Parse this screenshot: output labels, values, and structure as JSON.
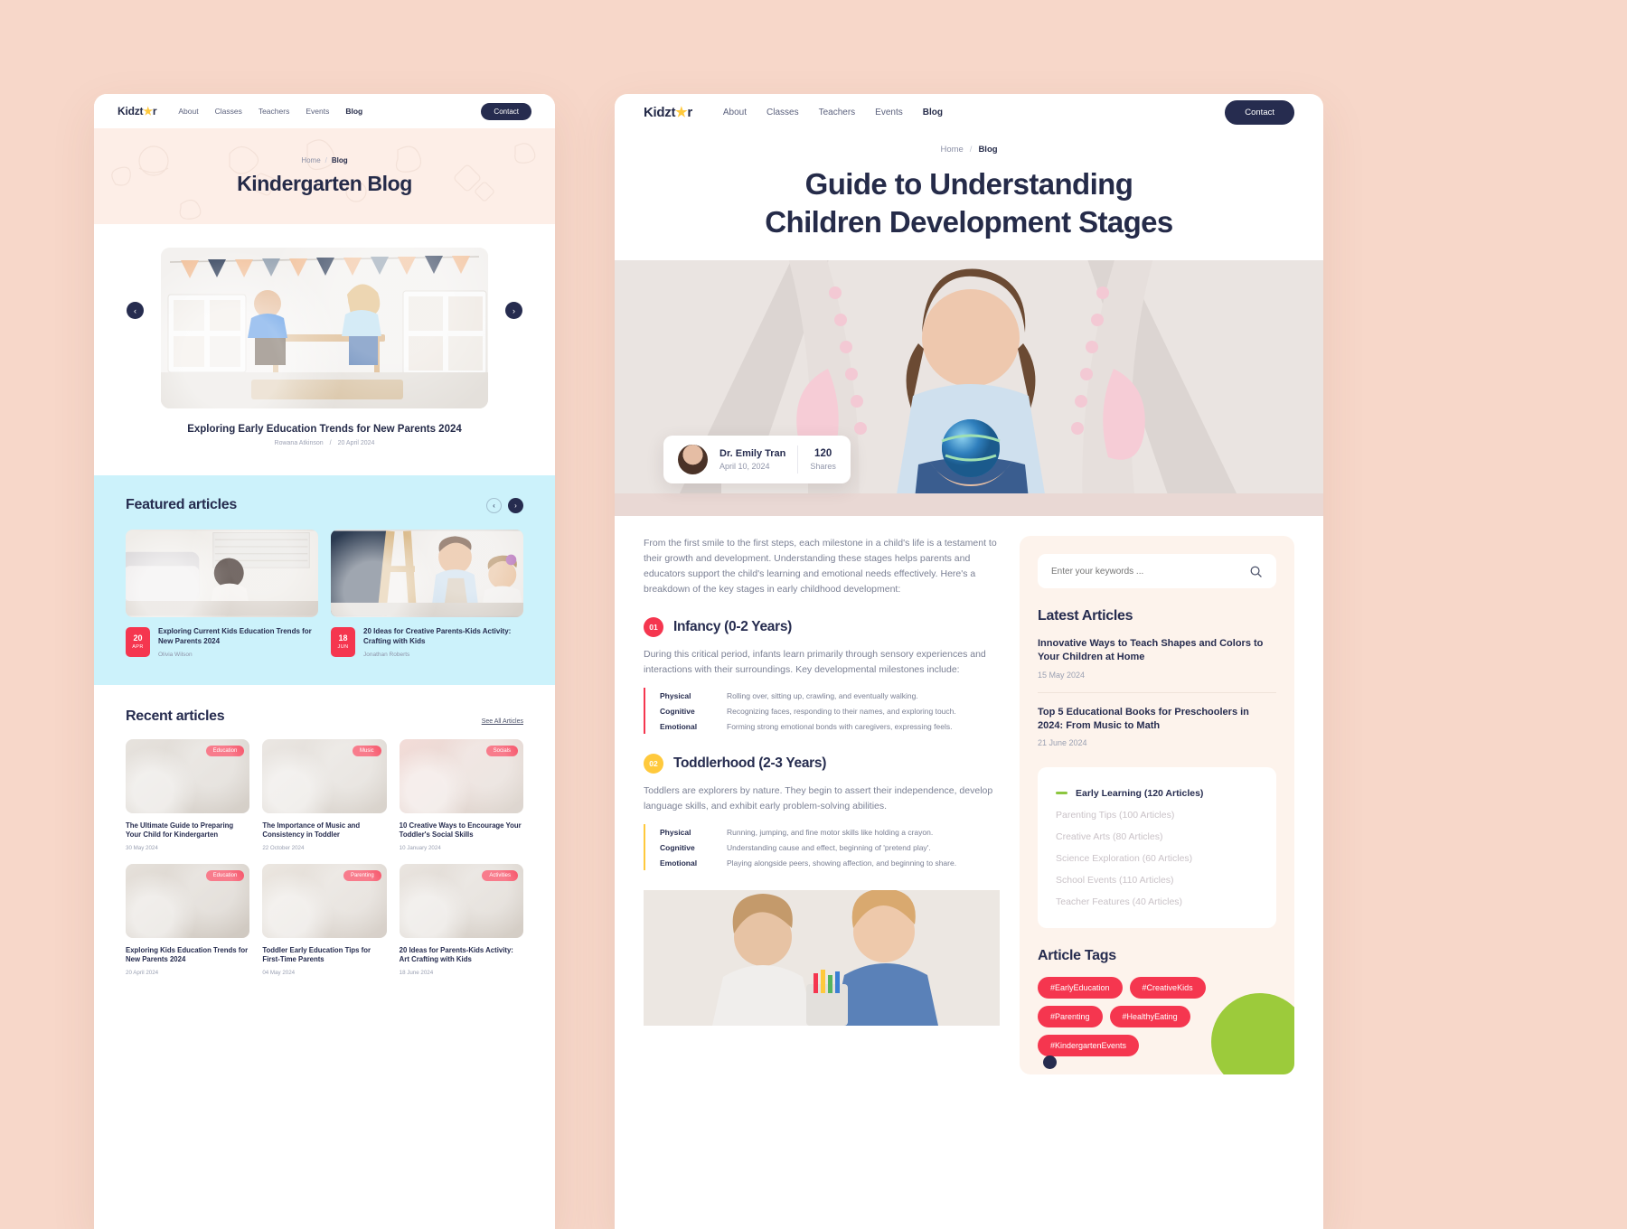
{
  "brand": {
    "name_pre": "Kidzt",
    "star": "★",
    "name_post": "r"
  },
  "nav": {
    "links": [
      "About",
      "Classes",
      "Teachers",
      "Events",
      "Blog"
    ],
    "active": "Blog",
    "contact_label": "Contact"
  },
  "left": {
    "breadcrumb": {
      "home": "Home",
      "sep": "/",
      "current": "Blog"
    },
    "page_title": "Kindergarten Blog",
    "slider": {
      "prev_icon": "‹",
      "next_icon": "›",
      "slide_title": "Exploring Early Education Trends for New Parents 2024",
      "author": "Rowana Atkinson",
      "sep": "/",
      "date": "20 April 2024"
    },
    "featured": {
      "heading": "Featured articles",
      "prev_icon": "‹",
      "next_icon": "›",
      "cards": [
        {
          "day": "20",
          "month": "APR",
          "title": "Exploring Current Kids Education Trends for New Parents 2024",
          "author": "Olivia Wilson"
        },
        {
          "day": "18",
          "month": "JUN",
          "title": "20 Ideas for Creative Parents-Kids Activity: Crafting with Kids",
          "author": "Jonathan Roberts"
        }
      ]
    },
    "recent": {
      "heading": "Recent articles",
      "see_all": "See All Articles",
      "cards": [
        {
          "badge": "Education",
          "title": "The Ultimate Guide to Preparing Your Child for Kindergarten",
          "date": "30 May 2024"
        },
        {
          "badge": "Music",
          "title": "The Importance of Music and Consistency in Toddler",
          "date": "22 October 2024"
        },
        {
          "badge": "Socials",
          "title": "10 Creative Ways to Encourage Your Toddler's Social Skills",
          "date": "10 January 2024"
        },
        {
          "badge": "Education",
          "title": "Exploring Kids Education Trends for New Parents 2024",
          "date": "20 April 2024"
        },
        {
          "badge": "Parenting",
          "title": "Toddler Early Education Tips for First-Time Parents",
          "date": "04 May 2024"
        },
        {
          "badge": "Activities",
          "title": "20 Ideas for Parents-Kids Activity: Art Crafting with Kids",
          "date": "18 June 2024"
        }
      ]
    }
  },
  "right": {
    "breadcrumb": {
      "home": "Home",
      "sep": "/",
      "current": "Blog"
    },
    "title_line1": "Guide to Understanding",
    "title_line2": "Children Development Stages",
    "author_card": {
      "name": "Dr. Emily Tran",
      "date": "April 10, 2024",
      "shares_count": "120",
      "shares_label": "Shares"
    },
    "intro": "From the first smile to the first steps, each milestone in a child's life is a testament to their growth and development. Understanding these stages helps parents and educators support the child's learning and emotional needs effectively. Here's a breakdown of the key stages in early childhood development:",
    "stages": [
      {
        "num": "01",
        "num_color": "#f5364f",
        "title": "Infancy (0-2 Years)",
        "desc": "During this critical period, infants learn primarily through sensory experiences and interactions with their surroundings. Key developmental milestones include:",
        "milestones": [
          {
            "key": "Physical",
            "value": "Rolling over, sitting up, crawling, and eventually walking."
          },
          {
            "key": "Cognitive",
            "value": "Recognizing faces, responding to their names, and exploring touch."
          },
          {
            "key": "Emotional",
            "value": "Forming strong emotional bonds with caregivers, expressing feels."
          }
        ]
      },
      {
        "num": "02",
        "num_color": "#ffc93c",
        "title": "Toddlerhood (2-3 Years)",
        "desc": "Toddlers are explorers by nature. They begin to assert their independence, develop language skills, and exhibit early problem-solving abilities.",
        "milestones": [
          {
            "key": "Physical",
            "value": "Running, jumping, and fine motor skills like holding a crayon."
          },
          {
            "key": "Cognitive",
            "value": "Understanding cause and effect, beginning of 'pretend play'."
          },
          {
            "key": "Emotional",
            "value": "Playing alongside peers, showing affection, and beginning to share."
          }
        ]
      }
    ],
    "sidebar": {
      "search_placeholder": "Enter your keywords ...",
      "search_icon": "search-icon",
      "latest_heading": "Latest Articles",
      "latest": [
        {
          "title": "Innovative Ways to Teach Shapes and Colors to Your Children at Home",
          "date": "15 May 2024"
        },
        {
          "title": "Top 5 Educational Books for Preschoolers in 2024: From Music to Math",
          "date": "21 June 2024"
        }
      ],
      "categories": [
        {
          "label": "Early Learning (120 Articles)",
          "active": true
        },
        {
          "label": "Parenting Tips (100 Articles)",
          "active": false
        },
        {
          "label": "Creative Arts (80 Articles)",
          "active": false
        },
        {
          "label": "Science Exploration (60 Articles)",
          "active": false
        },
        {
          "label": "School Events (110 Articles)",
          "active": false
        },
        {
          "label": "Teacher Features (40 Articles)",
          "active": false
        }
      ],
      "tags_heading": "Article Tags",
      "tags": [
        "#EarlyEducation",
        "#CreativeKids",
        "#Parenting",
        "#HealthyEating",
        "#KindergartenEvents"
      ]
    }
  },
  "colors": {
    "accent_red": "#f5364f",
    "navy": "#262c4f",
    "yellow": "#ffc93c",
    "green": "#8cc63f",
    "page_bg": "#f7d7c9"
  }
}
